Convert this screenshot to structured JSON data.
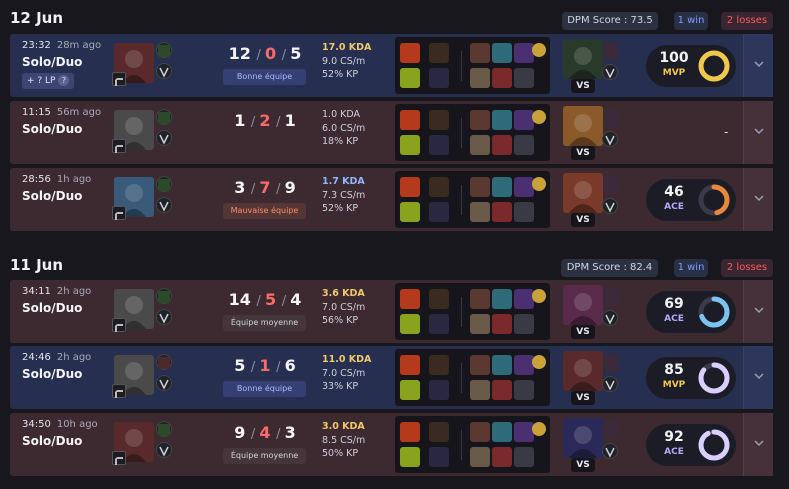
{
  "days": [
    {
      "date": "12 Jun",
      "dpm": "DPM Score : 73.5",
      "wins": "1 win",
      "losses": "2 losses"
    },
    {
      "date": "11 Jun",
      "dpm": "DPM Score : 82.4",
      "wins": "1 win",
      "losses": "2 losses"
    }
  ],
  "matches": [
    {
      "result": "win",
      "time": "23:32",
      "ago": "28m ago",
      "queue": "Solo/Duo",
      "lp": "+ ? LP",
      "kills": "12",
      "deaths": "0",
      "assists": "5",
      "tag": "Bonne équipe",
      "tag_type": "good",
      "kda_ratio": "17.0 KDA",
      "cs": "9.0 CS/m",
      "kp": "52% KP",
      "vs": "VS",
      "score": "100",
      "score_label": "MVP",
      "score_fraction": 1.0,
      "ring_color": "#f2c84c"
    },
    {
      "result": "loss",
      "time": "11:15",
      "ago": "56m ago",
      "queue": "Solo/Duo",
      "kills": "1",
      "deaths": "2",
      "assists": "1",
      "tag": "",
      "tag_type": "",
      "kda_ratio": "1.0 KDA",
      "cs": "6.0 CS/m",
      "kp": "18% KP",
      "vs": "VS",
      "score": "-",
      "score_label": "",
      "score_fraction": 0,
      "ring_color": ""
    },
    {
      "result": "loss",
      "time": "28:56",
      "ago": "1h ago",
      "queue": "Solo/Duo",
      "kills": "3",
      "deaths": "7",
      "assists": "9",
      "tag": "Mauvaise équipe",
      "tag_type": "bad",
      "kda_ratio": "1.7 KDA",
      "cs": "7.3 CS/m",
      "kp": "52% KP",
      "vs": "VS",
      "score": "46",
      "score_label": "ACE",
      "score_fraction": 0.46,
      "ring_color": "#e8883a"
    },
    {
      "result": "loss",
      "time": "34:11",
      "ago": "2h ago",
      "queue": "Solo/Duo",
      "kills": "14",
      "deaths": "5",
      "assists": "4",
      "tag": "Équipe moyenne",
      "tag_type": "avg",
      "kda_ratio": "3.6 KDA",
      "cs": "7.0 CS/m",
      "kp": "56% KP",
      "vs": "VS",
      "score": "69",
      "score_label": "ACE",
      "score_fraction": 0.69,
      "ring_color": "#7cc4f0"
    },
    {
      "result": "win",
      "time": "24:46",
      "ago": "2h ago",
      "queue": "Solo/Duo",
      "kills": "5",
      "deaths": "1",
      "assists": "6",
      "tag": "Bonne équipe",
      "tag_type": "good",
      "kda_ratio": "11.0 KDA",
      "cs": "7.0 CS/m",
      "kp": "33% KP",
      "vs": "VS",
      "score": "85",
      "score_label": "MVP",
      "score_fraction": 0.85,
      "ring_color": "#d9d0ff"
    },
    {
      "result": "loss",
      "time": "34:50",
      "ago": "10h ago",
      "queue": "Solo/Duo",
      "kills": "9",
      "deaths": "4",
      "assists": "3",
      "tag": "Équipe moyenne",
      "tag_type": "avg",
      "kda_ratio": "3.0 KDA",
      "cs": "8.5 CS/m",
      "kp": "50% KP",
      "vs": "VS",
      "score": "92",
      "score_label": "ACE",
      "score_fraction": 0.92,
      "ring_color": "#d9d0ff"
    }
  ],
  "colors": {
    "win_bg": "#262f50",
    "loss_bg": "#3d2a31",
    "mvp": "#f2c84c",
    "ace": "#b8a8ff",
    "deaths": "#ff6a6a"
  }
}
